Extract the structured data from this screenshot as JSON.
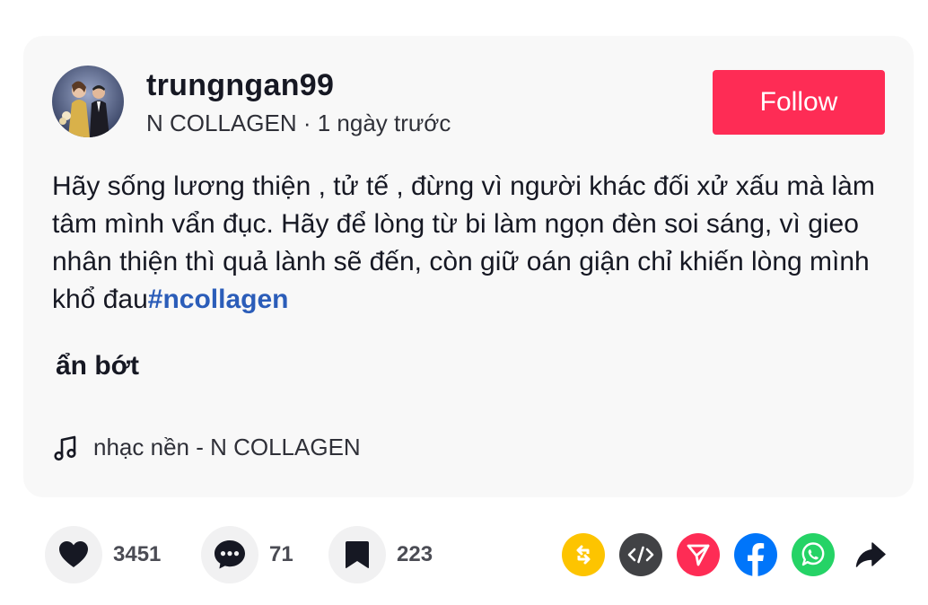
{
  "author": {
    "username": "trungngan99",
    "display_name": "N COLLAGEN",
    "separator": " · ",
    "time_ago": "1 ngày trước"
  },
  "follow_label": "Follow",
  "caption": {
    "text": "Hãy sống lương thiện , tử tế , đừng vì người khác đối xử xấu mà làm tâm mình vẩn đục. Hãy để lòng từ bi làm ngọn đèn soi sáng, vì gieo nhân thiện thì quả lành sẽ đến, còn giữ oán giận chỉ khiến lòng mình khổ đau",
    "hashtag": "#ncollagen"
  },
  "see_less_label": "ẩn bớt",
  "music": {
    "icon": "music-note-icon",
    "label": "nhạc nền - N COLLAGEN"
  },
  "stats": {
    "likes": "3451",
    "comments": "71",
    "saves": "223"
  },
  "share_targets": [
    {
      "icon": "repost-icon",
      "color": "#fdc400"
    },
    {
      "icon": "embed-icon",
      "color": "#414245"
    },
    {
      "icon": "send-icon",
      "color": "#fe2c55"
    },
    {
      "icon": "facebook-icon",
      "color": "#0075fa"
    },
    {
      "icon": "whatsapp-icon",
      "color": "#25d366"
    },
    {
      "icon": "share-arrow-icon",
      "color": "#161823"
    }
  ],
  "colors": {
    "accent": "#fe2c55",
    "hashtag": "#2b5db9",
    "card_bg": "#f8f8f8"
  }
}
